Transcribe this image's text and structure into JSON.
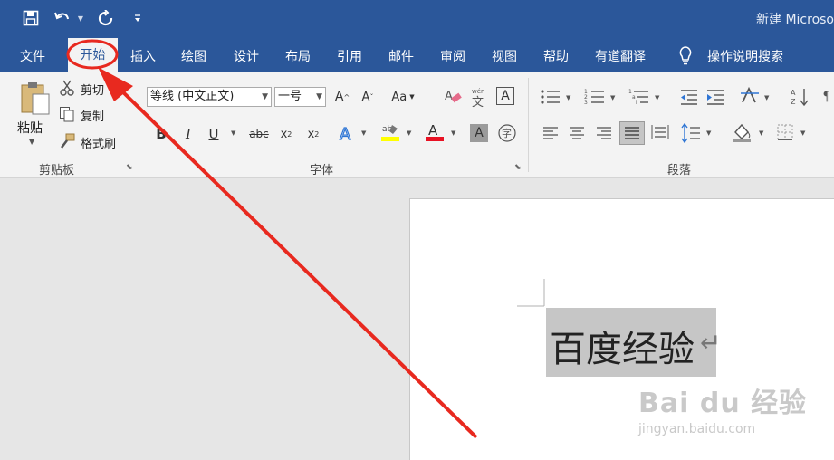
{
  "window": {
    "title": "新建 Microso"
  },
  "quick_access": {
    "save": "save-icon",
    "undo": "undo-icon",
    "redo": "redo-icon",
    "customize": "customize-icon"
  },
  "tabs": [
    {
      "label": "文件"
    },
    {
      "label": "开始"
    },
    {
      "label": "插入"
    },
    {
      "label": "绘图"
    },
    {
      "label": "设计"
    },
    {
      "label": "布局"
    },
    {
      "label": "引用"
    },
    {
      "label": "邮件"
    },
    {
      "label": "审阅"
    },
    {
      "label": "视图"
    },
    {
      "label": "帮助"
    },
    {
      "label": "有道翻译"
    }
  ],
  "tell_me": {
    "label": "操作说明搜索"
  },
  "clipboard": {
    "paste": "粘贴",
    "cut": "剪切",
    "copy": "复制",
    "format_painter": "格式刷",
    "group": "剪贴板"
  },
  "font": {
    "name": "等线 (中文正文)",
    "size": "一号",
    "change_case": "Aa",
    "bold": "B",
    "italic": "I",
    "underline": "U",
    "strike": "abc",
    "group": "字体"
  },
  "paragraph": {
    "group": "段落"
  },
  "document": {
    "text": "百度经验",
    "paragraph_mark": "↵"
  },
  "watermark": {
    "brand": "Bai du 经验",
    "url": "jingyan.baidu.com"
  },
  "colors": {
    "accent": "#2b579a",
    "annotation": "#e8291f"
  }
}
